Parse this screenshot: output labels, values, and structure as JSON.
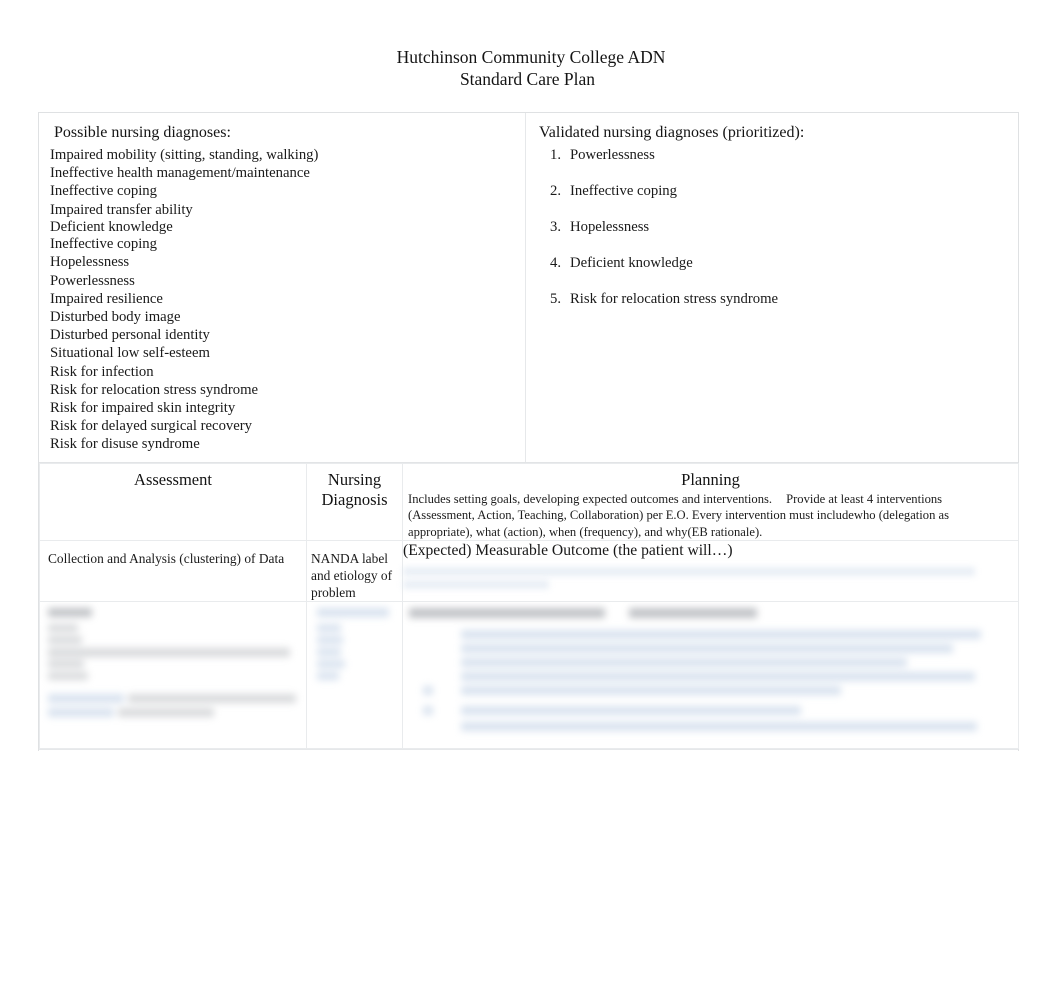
{
  "document": {
    "title_line1": "Hutchinson Community College ADN",
    "title_line2": "Standard Care Plan"
  },
  "possible_diagnoses": {
    "heading": "Possible nursing diagnoses:",
    "items": [
      "Impaired mobility (sitting, standing, walking)",
      "Ineffective health management/maintenance",
      "Ineffective coping",
      "Impaired transfer ability",
      "Deficient knowledge",
      "Ineffective coping",
      "Hopelessness",
      "Powerlessness",
      "Impaired resilience",
      "Disturbed body image",
      "Disturbed personal identity",
      "Situational low self-esteem",
      "Risk for infection",
      "Risk for relocation stress syndrome",
      "Risk for impaired skin integrity",
      "Risk for delayed surgical recovery",
      "Risk for disuse syndrome"
    ]
  },
  "validated_diagnoses": {
    "heading": "Validated nursing diagnoses (prioritized):",
    "items": [
      {
        "number": "1.",
        "label": "Powerlessness"
      },
      {
        "number": "2.",
        "label": "Ineffective coping"
      },
      {
        "number": "3.",
        "label": "Hopelessness"
      },
      {
        "number": "4.",
        "label": "Deficient knowledge"
      },
      {
        "number": "5.",
        "label": "Risk for relocation stress syndrome"
      }
    ]
  },
  "care_plan_table": {
    "headers": {
      "assessment": "Assessment",
      "nursing_diagnosis_line1": "Nursing",
      "nursing_diagnosis_line2": "Diagnosis",
      "planning": "Planning"
    },
    "planning_description": {
      "part1": "Includes setting goals, developing expected outcomes and interventions.",
      "part2": "Provide at least 4 interventions (Assessment, Action, Teaching, Collaboration) per E.O. Every intervention must include",
      "part3": "who",
      "part4": "(delegation as appropriate),",
      "part5": "what",
      "part6": "(action),",
      "part7": "when",
      "part8": "(frequency), and",
      "part9": "why",
      "part10": "(EB rationale)."
    },
    "subheaders": {
      "assessment": "Collection and Analysis (clustering) of Data",
      "nursing_diagnosis": "NANDA label and etiology of problem",
      "planning_outcome": "(Expected) Measurable Outcome (the patient will…)"
    }
  },
  "colors": {
    "text": "#1a1a1a",
    "border": "#e2e4e6",
    "redacted_blue": "#dbe4f0",
    "page_background": "#ffffff"
  }
}
